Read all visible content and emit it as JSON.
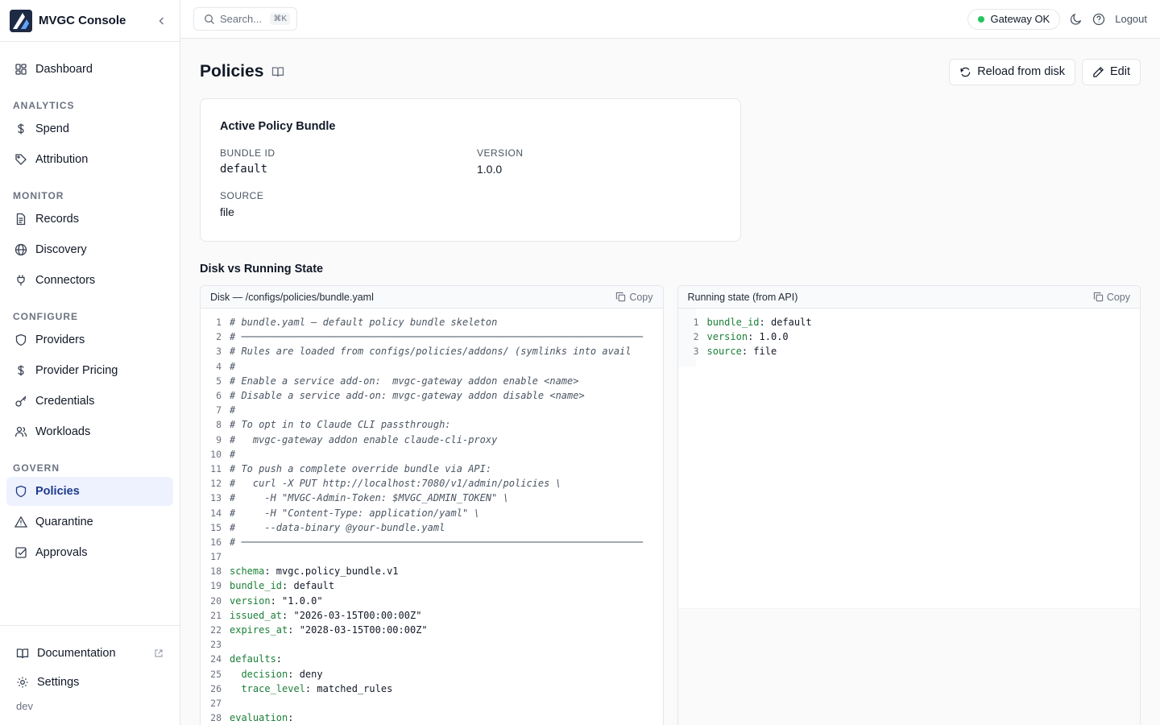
{
  "app": {
    "title": "MVGC Console",
    "env": "dev"
  },
  "sidebar": {
    "dashboard": "Dashboard",
    "sections": [
      {
        "label": "ANALYTICS",
        "items": [
          {
            "label": "Spend",
            "icon": "dollar-icon"
          },
          {
            "label": "Attribution",
            "icon": "tag-icon"
          }
        ]
      },
      {
        "label": "MONITOR",
        "items": [
          {
            "label": "Records",
            "icon": "file-text-icon"
          },
          {
            "label": "Discovery",
            "icon": "globe-icon"
          },
          {
            "label": "Connectors",
            "icon": "plug-icon"
          }
        ]
      },
      {
        "label": "CONFIGURE",
        "items": [
          {
            "label": "Providers",
            "icon": "shield-icon"
          },
          {
            "label": "Provider Pricing",
            "icon": "dollar-icon"
          },
          {
            "label": "Credentials",
            "icon": "key-icon"
          },
          {
            "label": "Workloads",
            "icon": "users-icon"
          }
        ]
      },
      {
        "label": "GOVERN",
        "items": [
          {
            "label": "Policies",
            "icon": "shield-icon",
            "active": true
          },
          {
            "label": "Quarantine",
            "icon": "alert-triangle-icon"
          },
          {
            "label": "Approvals",
            "icon": "check-square-icon"
          }
        ]
      }
    ],
    "footer": {
      "documentation": "Documentation",
      "settings": "Settings"
    }
  },
  "topbar": {
    "search_placeholder": "Search...",
    "search_shortcut": "⌘K",
    "gateway_status": "Gateway OK",
    "status_color": "#22c55e",
    "logout": "Logout"
  },
  "page": {
    "title": "Policies",
    "actions": {
      "reload": "Reload from disk",
      "edit": "Edit"
    }
  },
  "bundle_card": {
    "title": "Active Policy Bundle",
    "bundle_id_label": "BUNDLE ID",
    "bundle_id": "default",
    "version_label": "VERSION",
    "version": "1.0.0",
    "source_label": "SOURCE",
    "source": "file"
  },
  "state": {
    "section_title": "Disk vs Running State",
    "copy_label": "Copy",
    "disk": {
      "title": "Disk — /configs/policies/bundle.yaml",
      "lines": [
        {
          "n": "1",
          "t": "comment",
          "text": "# bundle.yaml — default policy bundle skeleton"
        },
        {
          "n": "2",
          "t": "comment",
          "text": "# ─────────────────────────────────────────────────────────────────────"
        },
        {
          "n": "3",
          "t": "comment",
          "text": "# Rules are loaded from configs/policies/addons/ (symlinks into avail"
        },
        {
          "n": "4",
          "t": "comment",
          "text": "#"
        },
        {
          "n": "5",
          "t": "comment",
          "text": "# Enable a service add-on:  mvgc-gateway addon enable <name>"
        },
        {
          "n": "6",
          "t": "comment",
          "text": "# Disable a service add-on: mvgc-gateway addon disable <name>"
        },
        {
          "n": "7",
          "t": "comment",
          "text": "#"
        },
        {
          "n": "8",
          "t": "comment",
          "text": "# To opt in to Claude CLI passthrough:"
        },
        {
          "n": "9",
          "t": "comment",
          "text": "#   mvgc-gateway addon enable claude-cli-proxy"
        },
        {
          "n": "10",
          "t": "comment",
          "text": "#"
        },
        {
          "n": "11",
          "t": "comment",
          "text": "# To push a complete override bundle via API:"
        },
        {
          "n": "12",
          "t": "comment",
          "text": "#   curl -X PUT http://localhost:7080/v1/admin/policies \\"
        },
        {
          "n": "13",
          "t": "comment",
          "text": "#     -H \"MVGC-Admin-Token: $MVGC_ADMIN_TOKEN\" \\"
        },
        {
          "n": "14",
          "t": "comment",
          "text": "#     -H \"Content-Type: application/yaml\" \\"
        },
        {
          "n": "15",
          "t": "comment",
          "text": "#     --data-binary @your-bundle.yaml"
        },
        {
          "n": "16",
          "t": "comment",
          "text": "# ─────────────────────────────────────────────────────────────────────"
        },
        {
          "n": "17",
          "t": "blank",
          "text": ""
        },
        {
          "n": "18",
          "t": "kv",
          "key": "schema",
          "value": " mvgc.policy_bundle.v1"
        },
        {
          "n": "19",
          "t": "kv",
          "key": "bundle_id",
          "value": " default"
        },
        {
          "n": "20",
          "t": "kv",
          "key": "version",
          "value": " \"1.0.0\""
        },
        {
          "n": "21",
          "t": "kv",
          "key": "issued_at",
          "value": " \"2026-03-15T00:00:00Z\""
        },
        {
          "n": "22",
          "t": "kv",
          "key": "expires_at",
          "value": " \"2028-03-15T00:00:00Z\""
        },
        {
          "n": "23",
          "t": "blank",
          "text": ""
        },
        {
          "n": "24",
          "t": "kv",
          "key": "defaults",
          "value": ""
        },
        {
          "n": "25",
          "t": "kv",
          "key": "  decision",
          "value": " deny"
        },
        {
          "n": "26",
          "t": "kv",
          "key": "  trace_level",
          "value": " matched_rules"
        },
        {
          "n": "27",
          "t": "blank",
          "text": ""
        },
        {
          "n": "28",
          "t": "kv",
          "key": "evaluation",
          "value": ""
        }
      ]
    },
    "running": {
      "title": "Running state (from API)",
      "lines": [
        {
          "n": "1",
          "t": "kv",
          "key": "bundle_id",
          "value": " default"
        },
        {
          "n": "2",
          "t": "kv",
          "key": "version",
          "value": " 1.0.0"
        },
        {
          "n": "3",
          "t": "kv",
          "key": "source",
          "value": " file"
        }
      ]
    }
  }
}
